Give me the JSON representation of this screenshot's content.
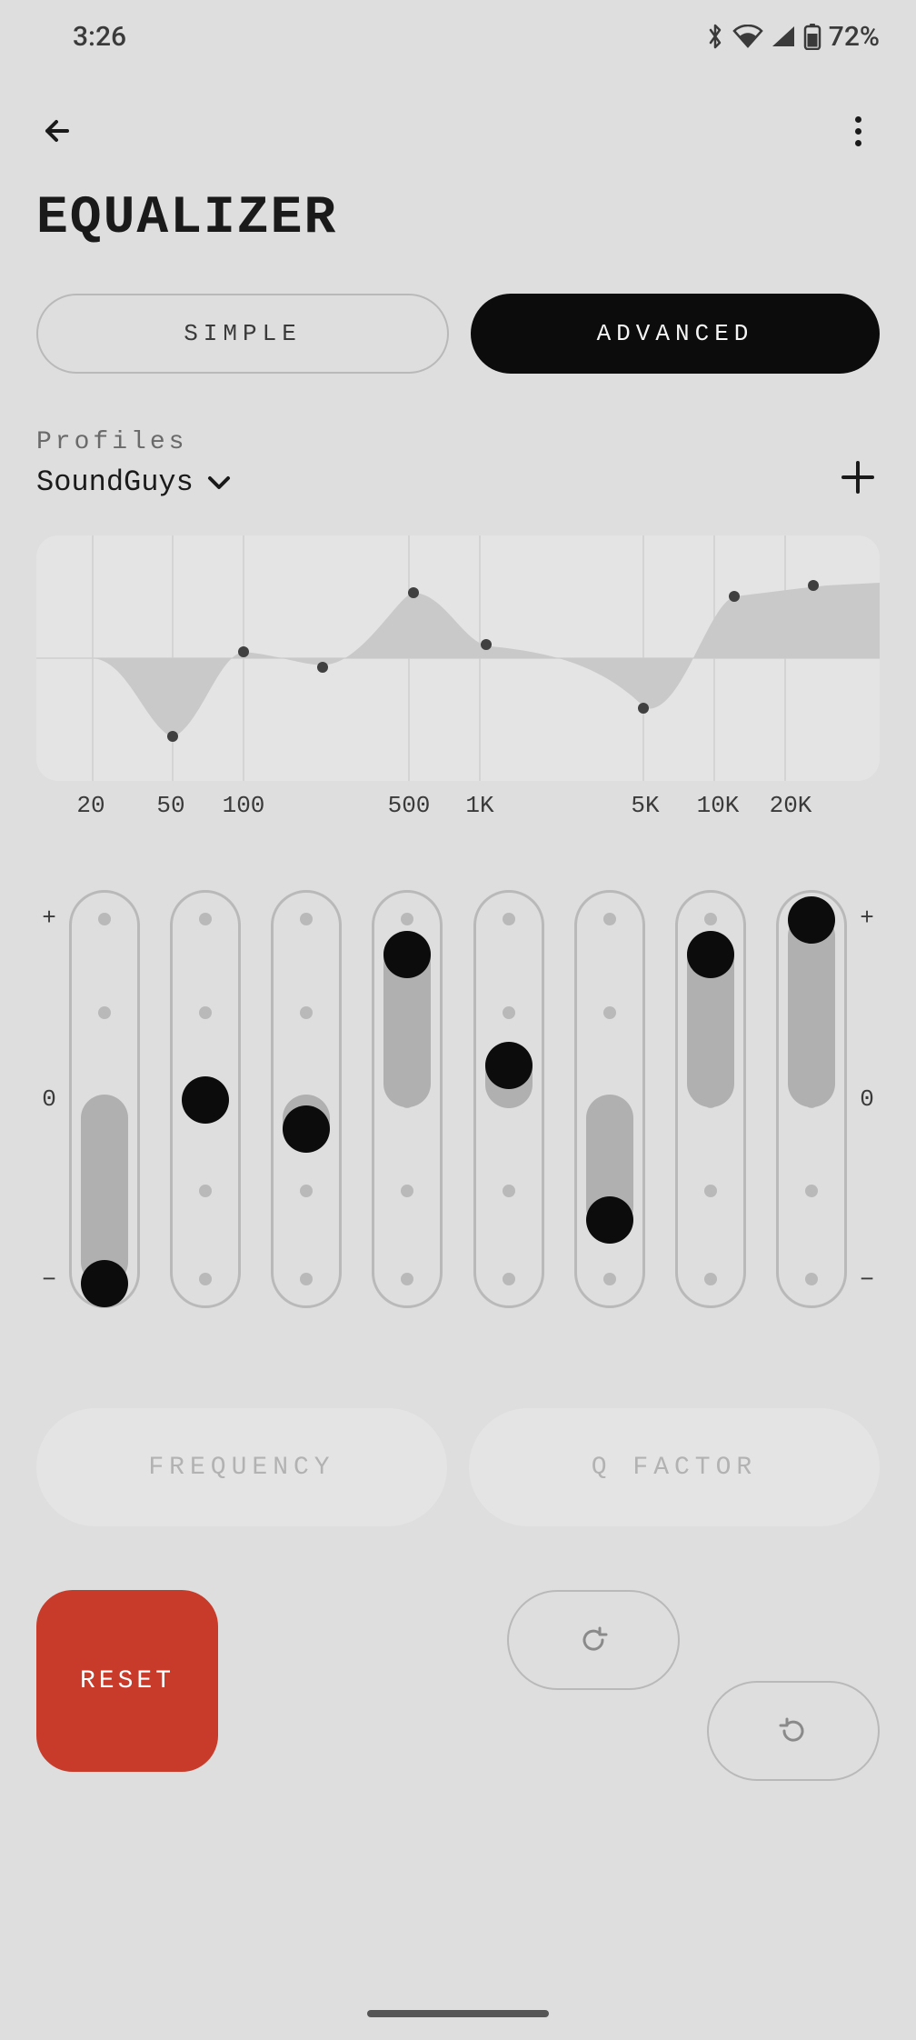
{
  "status_bar": {
    "time": "3:26",
    "battery_text": "72%"
  },
  "header": {
    "title": "EQUALIZER"
  },
  "tabs": {
    "simple": "SIMPLE",
    "advanced": "ADVANCED",
    "active": "advanced"
  },
  "profiles": {
    "label": "Profiles",
    "selected": "SoundGuys"
  },
  "chart_data": {
    "type": "line",
    "title": "",
    "xlabel": "",
    "ylabel": "",
    "x_scale": "log",
    "x_ticks": [
      "20",
      "50",
      "100",
      "500",
      "1K",
      "5K",
      "10K",
      "20K"
    ],
    "y_range_db": [
      -10,
      10
    ],
    "series": [
      {
        "name": "eq-curve",
        "points_db": [
          {
            "x": "50",
            "y": -7.0
          },
          {
            "x": "100",
            "y": 0.5
          },
          {
            "x": "200",
            "y": -0.5
          },
          {
            "x": "450",
            "y": 5.5
          },
          {
            "x": "1K",
            "y": 1.0
          },
          {
            "x": "4K",
            "y": -4.5
          },
          {
            "x": "10K",
            "y": 5.0
          },
          {
            "x": "20K",
            "y": 6.0
          }
        ]
      }
    ]
  },
  "sliders": {
    "scale_plus": "+",
    "scale_zero": "0",
    "scale_minus": "−",
    "bands": [
      {
        "value": -10
      },
      {
        "value": 0
      },
      {
        "value": -1.5
      },
      {
        "value": 8
      },
      {
        "value": 2
      },
      {
        "value": -6.5
      },
      {
        "value": 8
      },
      {
        "value": 10
      }
    ]
  },
  "param_buttons": {
    "frequency": "FREQUENCY",
    "qfactor": "Q FACTOR"
  },
  "bottom": {
    "reset": "RESET"
  }
}
